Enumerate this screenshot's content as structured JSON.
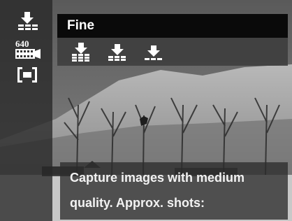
{
  "sidebar": {
    "items": [
      {
        "icon": "image-quality-icon",
        "selected": true
      },
      {
        "icon": "video-size-640-icon",
        "text": "640"
      },
      {
        "icon": "metering-icon"
      }
    ]
  },
  "panel": {
    "title": "Fine",
    "options": [
      {
        "icon": "quality-fine-icon",
        "selected": true
      },
      {
        "icon": "quality-normal-icon"
      },
      {
        "icon": "quality-economy-icon"
      }
    ]
  },
  "description": {
    "line1": "Capture images with medium",
    "line2": "quality. Approx. shots:"
  }
}
